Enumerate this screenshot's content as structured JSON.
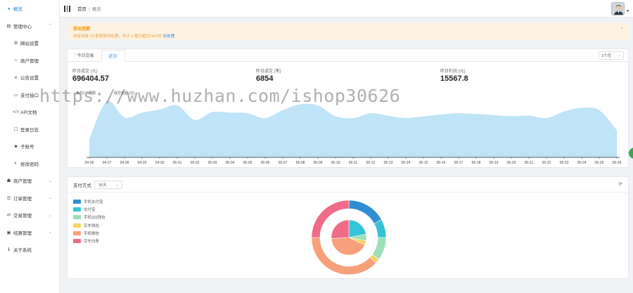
{
  "sidebar": {
    "items": [
      {
        "label": "概览",
        "icon": "dashboard-icon",
        "glyph": "◕",
        "sub": false,
        "active": true,
        "arrow": ""
      },
      {
        "label": "管理中心",
        "icon": "folder-icon",
        "glyph": "▤",
        "sub": false,
        "active": false,
        "arrow": "⌃"
      },
      {
        "label": "网站设置",
        "icon": "gear-icon",
        "glyph": "⚙",
        "sub": true,
        "active": false,
        "arrow": ""
      },
      {
        "label": "商户管理",
        "icon": "home-icon",
        "glyph": "⌂",
        "sub": true,
        "active": false,
        "arrow": ""
      },
      {
        "label": "公告设置",
        "icon": "ie-icon",
        "glyph": "e",
        "sub": true,
        "active": false,
        "arrow": ""
      },
      {
        "label": "支付接口",
        "icon": "card-icon",
        "glyph": "▭",
        "sub": true,
        "active": false,
        "arrow": ""
      },
      {
        "label": "API文档",
        "icon": "code-icon",
        "glyph": "</>",
        "sub": true,
        "active": false,
        "arrow": ""
      },
      {
        "label": "登录日志",
        "icon": "log-icon",
        "glyph": "☐",
        "sub": true,
        "active": false,
        "arrow": ""
      },
      {
        "label": "子账号",
        "icon": "users-icon",
        "glyph": "☻",
        "sub": true,
        "active": false,
        "arrow": ""
      },
      {
        "label": "修改密码",
        "icon": "key-icon",
        "glyph": "◐",
        "sub": true,
        "active": false,
        "arrow": ""
      },
      {
        "label": "商户管理",
        "icon": "user-group-icon",
        "glyph": "☗",
        "sub": false,
        "active": false,
        "arrow": "⌄"
      },
      {
        "label": "订单管理",
        "icon": "chart-icon",
        "glyph": "☰",
        "sub": false,
        "active": false,
        "arrow": "⌄"
      },
      {
        "label": "交易管理",
        "icon": "trade-icon",
        "glyph": "⇄",
        "sub": false,
        "active": false,
        "arrow": "⌄"
      },
      {
        "label": "结算管理",
        "icon": "money-icon",
        "glyph": "▣",
        "sub": false,
        "active": false,
        "arrow": "⌄"
      },
      {
        "label": "关于系统",
        "icon": "info-icon",
        "glyph": "ℹ",
        "sub": false,
        "active": false,
        "arrow": ""
      }
    ]
  },
  "header": {
    "breadcrumb_home": "首页",
    "breadcrumb_sep": "/",
    "breadcrumb_current": "概览"
  },
  "notice": {
    "title": "提现提醒",
    "body": "你有待审 15 条提现待处理，共计 1 笔已超过24小时",
    "link": "去处理",
    "close": "×"
  },
  "chart_card": {
    "tabs": [
      {
        "label": "今日交易",
        "icon": "bar-chart-icon",
        "glyph": "⫶",
        "active": false
      },
      {
        "label": "近日",
        "icon": "",
        "glyph": "",
        "active": true
      }
    ],
    "range_select": "1个月",
    "range_caret": "⌄",
    "stats": [
      {
        "label": "昨日成交 (元)",
        "value": "696404.57"
      },
      {
        "label": "昨日成交 (笔)",
        "value": "6854"
      },
      {
        "label": "昨日利润 (元)",
        "value": "15567.8"
      }
    ],
    "legend_left": "每日1个周期",
    "legend_right": "成交金额 (元)"
  },
  "chart_data": {
    "type": "area",
    "x": [
      "04-26",
      "04-27",
      "04-28",
      "04-29",
      "04-30",
      "05-01",
      "05-02",
      "05-03",
      "05-04",
      "05-05",
      "05-06",
      "05-07",
      "05-08",
      "05-09",
      "05-10",
      "05-11",
      "05-12",
      "05-13",
      "05-14",
      "05-15",
      "05-16",
      "05-17",
      "05-18",
      "05-19",
      "05-20",
      "05-21",
      "05-22",
      "05-23",
      "05-24",
      "05-25",
      "05-26"
    ],
    "values": [
      300,
      930,
      660,
      740,
      790,
      860,
      620,
      750,
      740,
      730,
      650,
      780,
      880,
      860,
      680,
      650,
      730,
      690,
      650,
      680,
      710,
      730,
      720,
      700,
      680,
      690,
      650,
      760,
      820,
      780,
      450
    ],
    "ylim": [
      0,
      1000
    ],
    "color": "#bfe3f7",
    "grid": false
  },
  "pay_card": {
    "title": "支付方式",
    "select": "30天",
    "select_caret": "⌄",
    "refresh": "⟳",
    "legend": [
      {
        "label": "手机支付宝",
        "color": "#2f8fd1"
      },
      {
        "label": "支付宝",
        "color": "#34c3d8"
      },
      {
        "label": "手机QQ钱包",
        "color": "#9ae0b8"
      },
      {
        "label": "京东钱包",
        "color": "#f7d460"
      },
      {
        "label": "手机微信",
        "color": "#f7a07a"
      },
      {
        "label": "京东白条",
        "color": "#f06b8a"
      }
    ]
  },
  "pie_data": {
    "type": "pie",
    "outer_ring": [
      {
        "label": "手机支付宝",
        "value": 17,
        "color": "#2f8fd1"
      },
      {
        "label": "支付宝",
        "value": 8,
        "color": "#34c3d8"
      },
      {
        "label": "手机QQ钱包",
        "value": 10,
        "color": "#9ae0b8"
      },
      {
        "label": "京东钱包",
        "value": 2,
        "color": "#f7d460"
      },
      {
        "label": "手机微信",
        "value": 38,
        "color": "#f7a07a"
      },
      {
        "label": "京东白条",
        "value": 25,
        "color": "#f06b8a"
      }
    ],
    "inner_pie": [
      {
        "label": "支付宝",
        "value": 22,
        "color": "#34c3d8"
      },
      {
        "label": "手机QQ钱包",
        "value": 6,
        "color": "#9ae0b8"
      },
      {
        "label": "京东钱包",
        "value": 4,
        "color": "#f7d460"
      },
      {
        "label": "手机微信",
        "value": 42,
        "color": "#f7a07a"
      },
      {
        "label": "京东白条",
        "value": 26,
        "color": "#f06b8a"
      }
    ]
  },
  "watermark": "https://www.huzhan.com/ishop30626"
}
